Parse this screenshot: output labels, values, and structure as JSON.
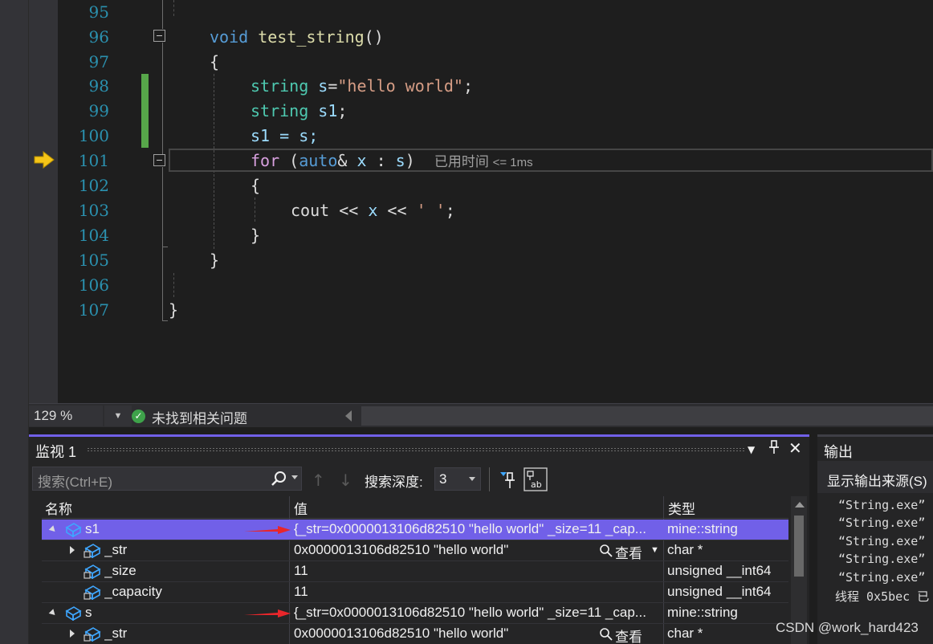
{
  "editor": {
    "line_numbers": [
      "95",
      "96",
      "97",
      "98",
      "99",
      "100",
      "101",
      "102",
      "103",
      "104",
      "105",
      "106",
      "107"
    ],
    "code": {
      "l96_void": "void",
      "l96_fn": "test_string",
      "l96_paren": "()",
      "l97_brace": "{",
      "l98_type": "string",
      "l98_var": "s",
      "l98_eq": "=",
      "l98_str": "\"hello world\"",
      "l98_semi": ";",
      "l99_type": "string",
      "l99_var": "s1",
      "l99_semi": ";",
      "l100_text": "s1 = s;",
      "l101_for": "for",
      "l101_open": " (",
      "l101_auto": "auto",
      "l101_amp": "& ",
      "l101_x": "x",
      "l101_colon": " : ",
      "l101_s": "s",
      "l101_close": ")",
      "l102_brace": "{",
      "l103_cout": "cout",
      "l103_op1": " << ",
      "l103_x": "x",
      "l103_op2": " << ",
      "l103_char": "' '",
      "l103_semi": ";",
      "l104_brace": "}",
      "l105_brace": "}",
      "l107_brace": "}"
    },
    "perf_tip_label": "已用时间",
    "perf_tip_value": "<= 1ms"
  },
  "statusbar": {
    "zoom": "129 %",
    "issues": "未找到相关问题"
  },
  "watch": {
    "title": "监视 1",
    "search_placeholder": "搜索(Ctrl+E)",
    "depth_label": "搜索深度:",
    "depth_value": "3",
    "columns": {
      "name": "名称",
      "value": "值",
      "type": "类型"
    },
    "rows": [
      {
        "name": "s1",
        "value": "{_str=0x0000013106d82510 \"hello world\" _size=11 _cap...",
        "type": "mine::string"
      },
      {
        "name": "_str",
        "value": "0x0000013106d82510 \"hello world\"",
        "view": "查看",
        "type": "char *"
      },
      {
        "name": "_size",
        "value": "11",
        "type": "unsigned __int64"
      },
      {
        "name": "_capacity",
        "value": "11",
        "type": "unsigned __int64"
      },
      {
        "name": "s",
        "value": "{_str=0x0000013106d82510 \"hello world\" _size=11 _cap...",
        "type": "mine::string"
      },
      {
        "name": "_str",
        "value": "0x0000013106d82510 \"hello world\"",
        "view": "查看",
        "type": "char *"
      }
    ]
  },
  "output": {
    "title": "输出",
    "source_label": "显示输出来源(S)",
    "lines": [
      "“String.exe”",
      "“String.exe”",
      "“String.exe”",
      "“String.exe”",
      "“String.exe”",
      "线程 0x5bec 已"
    ]
  },
  "watermark": "CSDN @work_hard423",
  "colors": {
    "selection": "#7160e8",
    "change_bar": "#57a64a",
    "line_number": "#2b91af",
    "keyword": "#569cd6"
  }
}
